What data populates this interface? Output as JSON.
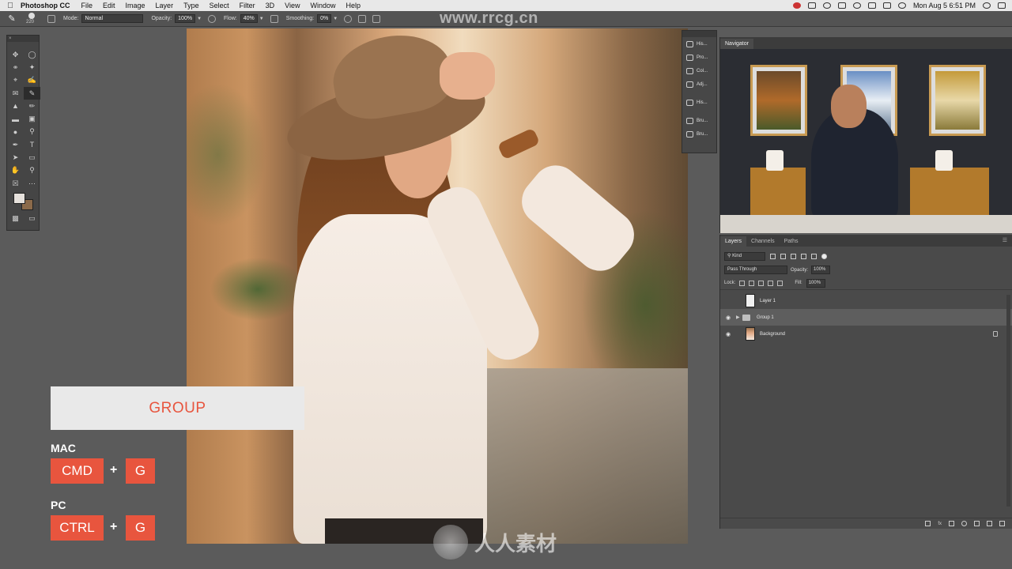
{
  "menubar": {
    "app_name": "Photoshop CC",
    "items": [
      "File",
      "Edit",
      "Image",
      "Layer",
      "Type",
      "Select",
      "Filter",
      "3D",
      "View",
      "Window",
      "Help"
    ],
    "clock": "Mon Aug 5  6:51 PM"
  },
  "options": {
    "brush_size": "220",
    "mode_label": "Mode:",
    "mode_value": "Normal",
    "opacity_label": "Opacity:",
    "opacity_value": "100%",
    "flow_label": "Flow:",
    "flow_value": "40%",
    "smoothing_label": "Smoothing:",
    "smoothing_value": "0%"
  },
  "mini_panel": {
    "items": [
      "His...",
      "Pro...",
      "Col...",
      "Adj...",
      "His...",
      "Bru...",
      "Bru..."
    ]
  },
  "navigator": {
    "tab": "Navigator"
  },
  "layers_panel": {
    "tabs": [
      "Layers",
      "Channels",
      "Paths"
    ],
    "filter_kind": "Kind",
    "blend_mode": "Pass Through",
    "opacity_label": "Opacity:",
    "opacity_value": "100%",
    "lock_label": "Lock:",
    "fill_label": "Fill:",
    "fill_value": "100%",
    "layers": [
      {
        "name": "Layer 1"
      },
      {
        "name": "Group 1"
      },
      {
        "name": "Background"
      }
    ],
    "footer_fx": "fx"
  },
  "overlay": {
    "group_title": "GROUP",
    "mac_label": "MAC",
    "mac_key1": "CMD",
    "mac_key2": "G",
    "pc_label": "PC",
    "pc_key1": "CTRL",
    "pc_key2": "G",
    "plus": "+"
  },
  "watermarks": {
    "top": "www.rrcg.cn",
    "bottom": "人人素材"
  },
  "colors": {
    "accent": "#e8553e",
    "foreground_swatch": "#e6e1dc",
    "background_swatch": "#8b6a4a"
  }
}
